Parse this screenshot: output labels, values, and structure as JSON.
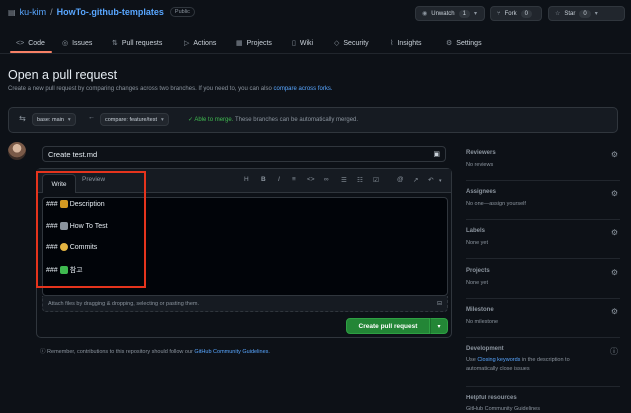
{
  "repo": {
    "owner": "ku-kim",
    "separator": "/",
    "name": "HowTo-.github-templates",
    "visibility": "Public"
  },
  "repo_actions": {
    "unwatch_label": "Unwatch",
    "unwatch_count": "1",
    "fork_label": "Fork",
    "fork_count": "0",
    "star_label": "Star",
    "star_count": "0"
  },
  "tabs": [
    {
      "label": "Code",
      "icon": "code-icon"
    },
    {
      "label": "Issues",
      "icon": "issue-icon"
    },
    {
      "label": "Pull requests",
      "icon": "pull-request-icon"
    },
    {
      "label": "Actions",
      "icon": "play-icon"
    },
    {
      "label": "Projects",
      "icon": "table-icon"
    },
    {
      "label": "Wiki",
      "icon": "book-icon"
    },
    {
      "label": "Security",
      "icon": "shield-icon"
    },
    {
      "label": "Insights",
      "icon": "graph-icon"
    },
    {
      "label": "Settings",
      "icon": "gear-icon"
    }
  ],
  "page": {
    "title": "Open a pull request",
    "subtitle": "Create a new pull request by comparing changes across two branches. If you need to, you can also",
    "subtitle_link": "compare across forks."
  },
  "compare": {
    "base": "base: main",
    "compare": "compare: feature/test",
    "status": "Able to merge.",
    "status_detail": "These branches can be automatically merged."
  },
  "editor": {
    "title_value": "Create test.md",
    "tab_write": "Write",
    "tab_preview": "Preview",
    "lines": [
      {
        "prefix": "###",
        "emoji_color": "#d29922",
        "text": "Description"
      },
      {
        "prefix": "###",
        "emoji_color": "#8b949e",
        "text": "How To Test"
      },
      {
        "prefix": "###",
        "emoji_color": "#e3b341",
        "text": "Commits"
      },
      {
        "prefix": "###",
        "emoji_color": "#3fb950",
        "text": "참고"
      }
    ],
    "attach_hint": "Attach files by dragging & dropping, selecting or pasting them.",
    "submit_label": "Create pull request",
    "remember_text": "Remember, contributions to this repository should follow our",
    "remember_link": "GitHub Community Guidelines."
  },
  "sidebar": {
    "reviewers": {
      "title": "Reviewers",
      "value": "No reviews"
    },
    "assignees": {
      "title": "Assignees",
      "value": "No one—assign yourself"
    },
    "labels": {
      "title": "Labels",
      "value": "None yet"
    },
    "projects": {
      "title": "Projects",
      "value": "None yet"
    },
    "milestone": {
      "title": "Milestone",
      "value": "No milestone"
    },
    "development": {
      "title": "Development",
      "value_prefix": "Use",
      "value_link": "Closing keywords",
      "value_suffix": "in the description to automatically close issues"
    },
    "helpful": {
      "title": "Helpful resources",
      "link": "GitHub Community Guidelines"
    }
  },
  "colors": {
    "accent": "#f78166",
    "primary_button": "#238636",
    "link": "#58a6ff",
    "success": "#3fb950",
    "highlight_box": "#e5341d"
  }
}
